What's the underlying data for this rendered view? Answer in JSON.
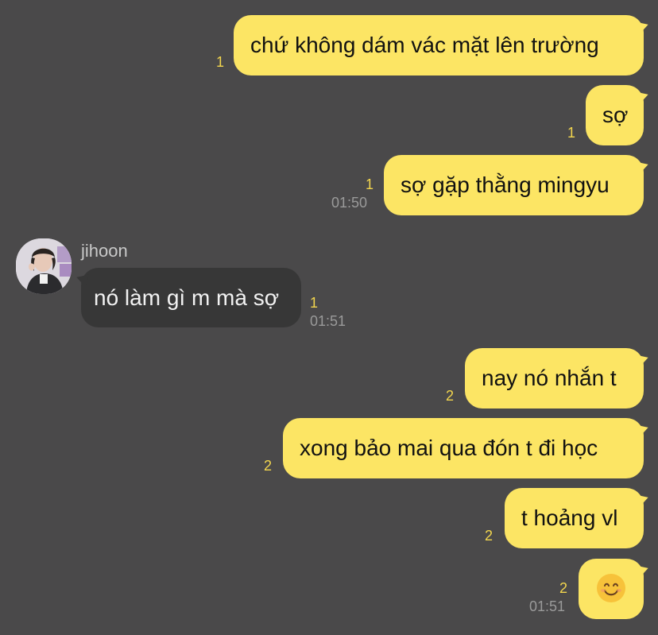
{
  "messages": [
    {
      "text": "chứ không dám vác mặt lên trường",
      "unread": "1",
      "time": ""
    },
    {
      "text": "sợ",
      "unread": "1",
      "time": ""
    },
    {
      "text": "sợ gặp thằng mingyu",
      "unread": "1",
      "time": "01:50"
    },
    {
      "sender": "jihoon",
      "text": "nó làm gì m mà sợ",
      "unread": "1",
      "time": "01:51"
    },
    {
      "text": "nay nó nhắn t",
      "unread": "2",
      "time": ""
    },
    {
      "text": "xong bảo mai qua đón t đi học",
      "unread": "2",
      "time": ""
    },
    {
      "text": "t hoảng vl",
      "unread": "2",
      "time": ""
    },
    {
      "emoji": "smiling-face",
      "unread": "2",
      "time": "01:51"
    }
  ]
}
